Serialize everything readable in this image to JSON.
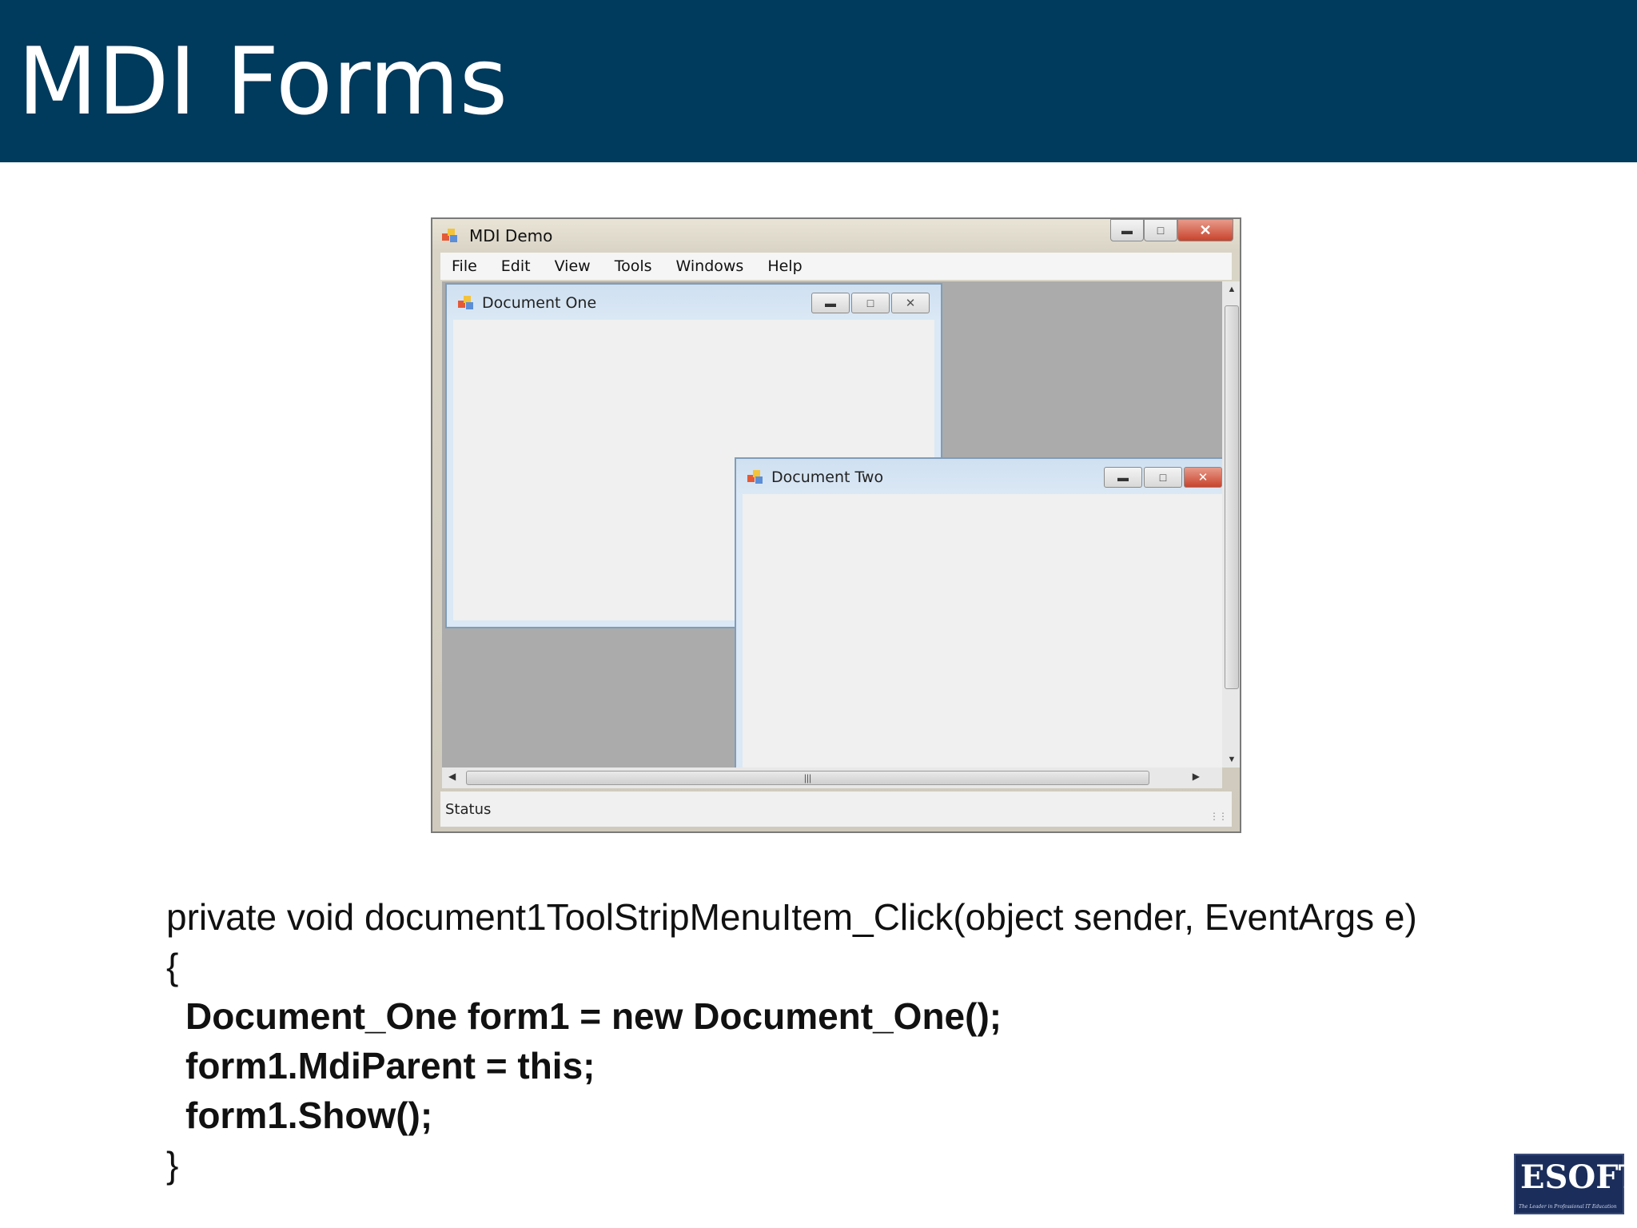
{
  "slide": {
    "title": "MDI Forms"
  },
  "window": {
    "title": "MDI Demo",
    "menu": [
      "File",
      "Edit",
      "View",
      "Tools",
      "Windows",
      "Help"
    ],
    "status": "Status",
    "children": [
      {
        "title": "Document One"
      },
      {
        "title": "Document Two"
      }
    ]
  },
  "code": {
    "signature": "private void document1ToolStripMenuItem_Click(object sender, EventArgs e)",
    "open_brace": "{",
    "line1": "Document_One form1 = new Document_One();",
    "line2": "form1.MdiParent = this;",
    "line3": "form1.Show();",
    "close_brace": "}"
  },
  "logo": {
    "text": "ESOFT",
    "tagline": "The Leader in Professional IT Education"
  },
  "colors": {
    "header": "#003a5c",
    "client_bg": "#ababab",
    "logo_bg": "#1b2d5a"
  }
}
